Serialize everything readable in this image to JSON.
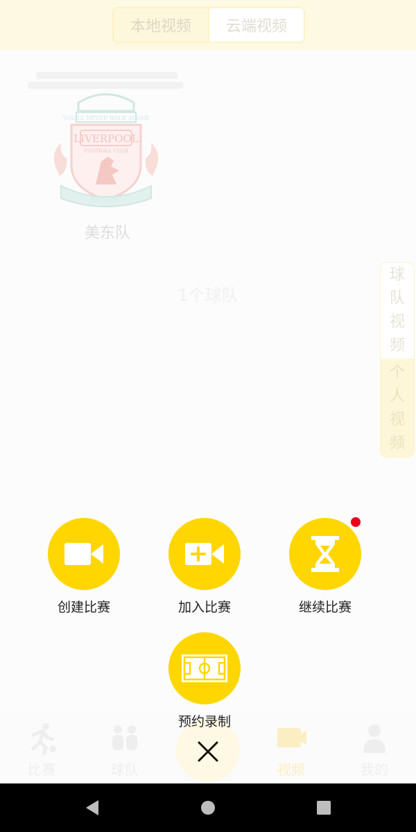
{
  "top_tabs": {
    "local": "本地视频",
    "cloud": "云端视频"
  },
  "team": {
    "name": "美东队",
    "count_text": "1个球队"
  },
  "side_tabs": {
    "team": "球队视频",
    "personal": "个人视频"
  },
  "actions": {
    "create": "创建比赛",
    "join": "加入比赛",
    "continue": "继续比赛",
    "schedule": "预约录制"
  },
  "bottom_nav": {
    "match": "比赛",
    "team": "球队",
    "video": "视频",
    "mine": "我的"
  },
  "colors": {
    "accent": "#ffd600",
    "badge": "#e8001b",
    "label": "#222222"
  },
  "icons": {
    "create": "video-camera-icon",
    "join": "video-add-icon",
    "continue": "hourglass-icon",
    "schedule": "football-pitch-icon",
    "close": "close-icon"
  }
}
